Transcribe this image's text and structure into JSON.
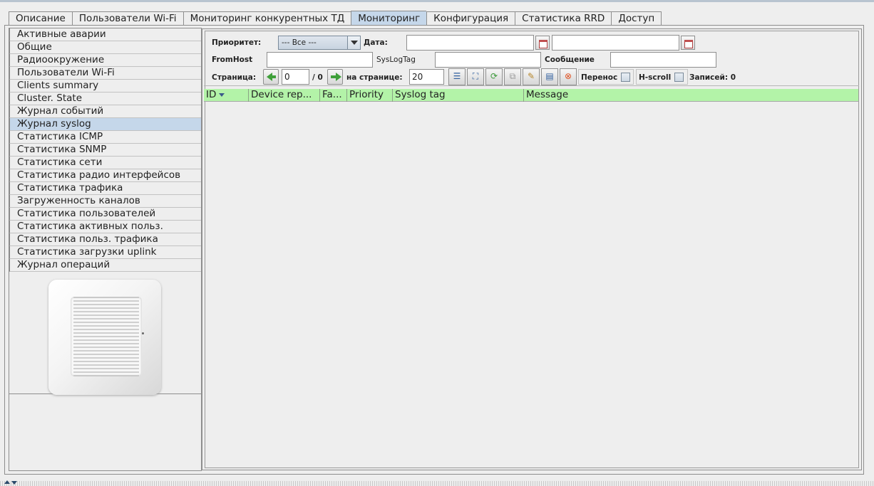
{
  "tabs": [
    {
      "label": "Описание",
      "active": false
    },
    {
      "label": "Пользователи Wi-Fi",
      "active": false
    },
    {
      "label": "Мониторинг конкурентных ТД",
      "active": false
    },
    {
      "label": "Мониторинг",
      "active": true
    },
    {
      "label": "Конфигурация",
      "active": false
    },
    {
      "label": "Статистика RRD",
      "active": false
    },
    {
      "label": "Доступ",
      "active": false
    }
  ],
  "sidebar": {
    "selected": "Журнал syslog",
    "items": [
      "Активные аварии",
      "Общие",
      "Радиоокружение",
      "Пользователи Wi-Fi",
      "Clients summary",
      "Cluster. State",
      "Журнал событий",
      "Журнал syslog",
      "Статистика ICMP",
      "Статистика SNMP",
      "Статистика сети",
      "Статистика радио интерфейсов",
      "Статистика трафика",
      "Загруженность каналов",
      "Статистика пользователей",
      "Статистика активных польз.",
      "Статистика польз. трафика",
      "Статистика загрузки uplink",
      "Журнал операций"
    ]
  },
  "filters": {
    "priority_label": "Приоритет:",
    "priority_value": "--- Все ---",
    "date_label": "Дата:",
    "date_from": "",
    "date_to": "",
    "fromhost_label": "FromHost",
    "fromhost_value": "",
    "syslogtag_label": "SysLogTag",
    "syslogtag_value": "",
    "message_label": "Сообщение",
    "message_value": ""
  },
  "pager": {
    "page_label": "Страница:",
    "page_value": "0",
    "total_pages": "/ 0",
    "per_page_label": "на странице:",
    "per_page_value": "20",
    "wrap_label": "Перенос",
    "hscroll_label": "H-scroll",
    "records_label": "Записей: 0"
  },
  "toolbar_icons": [
    "columns-icon",
    "fit-icon",
    "refresh-icon",
    "copy-icon",
    "clear-filter-icon",
    "save-icon",
    "close-icon"
  ],
  "table": {
    "columns": [
      "ID",
      "Device rep...",
      "Fa...",
      "Priority",
      "Syslog tag",
      "Message"
    ],
    "sort_column": "ID",
    "rows": []
  },
  "colors": {
    "table_header": "#b3f3a8",
    "selection": "#c5d7ea"
  }
}
